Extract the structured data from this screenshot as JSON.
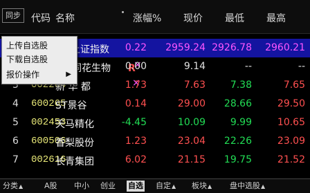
{
  "header": {
    "sync_button": "同步",
    "columns": {
      "code": "代码",
      "name": "名称",
      "change_pct": "涨幅%",
      "price": "现价",
      "low": "最低",
      "high": "最高"
    }
  },
  "rows": [
    {
      "index": "",
      "code": "",
      "name": "上证指数",
      "change_pct": "0.22",
      "price": "2959.24",
      "low": "2926.78",
      "high": "2960.21",
      "flag": ""
    },
    {
      "index": "",
      "code": "",
      "name": "同花生物",
      "change_pct": "0.00",
      "price": "9.14",
      "low": "--",
      "high": "--",
      "flag": "R"
    },
    {
      "index": "3",
      "code": "002264",
      "name": "新 华 都",
      "change_pct": "1.73",
      "price": "7.63",
      "low": "7.38",
      "high": "7.65",
      "flag": ""
    },
    {
      "index": "4",
      "code": "600265",
      "name": "ST景谷",
      "change_pct": "0.14",
      "price": "29.00",
      "low": "28.66",
      "high": "29.50",
      "flag": ""
    },
    {
      "index": "5",
      "code": "002453",
      "name": "天马精化",
      "change_pct": "-4.45",
      "price": "10.09",
      "low": "9.99",
      "high": "10.65",
      "flag": ""
    },
    {
      "index": "6",
      "code": "600506",
      "name": "香梨股份",
      "change_pct": "1.23",
      "price": "23.04",
      "low": "22.26",
      "high": "23.09",
      "flag": ""
    },
    {
      "index": "7",
      "code": "002616",
      "name": "长青集团",
      "change_pct": "6.02",
      "price": "21.15",
      "low": "19.75",
      "high": "21.52",
      "flag": ""
    }
  ],
  "context_menu": {
    "items": [
      "上传自选股",
      "下载自选股",
      "报价操作"
    ],
    "submenu_arrow": "▶"
  },
  "tabs": [
    {
      "label": "分类",
      "active": false,
      "arrow": true
    },
    {
      "label": "A股",
      "active": false,
      "arrow": false
    },
    {
      "label": "中小",
      "active": false,
      "arrow": false
    },
    {
      "label": "创业",
      "active": false,
      "arrow": false
    },
    {
      "label": "自选",
      "active": true,
      "arrow": false
    },
    {
      "label": "自定",
      "active": false,
      "arrow": true
    },
    {
      "label": "板块",
      "active": false,
      "arrow": true
    },
    {
      "label": "盘中选股",
      "active": false,
      "arrow": true
    }
  ],
  "colors": {
    "up": "#ff5050",
    "down": "#22dd55",
    "code": "#e8e878",
    "selected_row_bg": "#1414a0",
    "selected_row_text": "#ff55ff"
  }
}
